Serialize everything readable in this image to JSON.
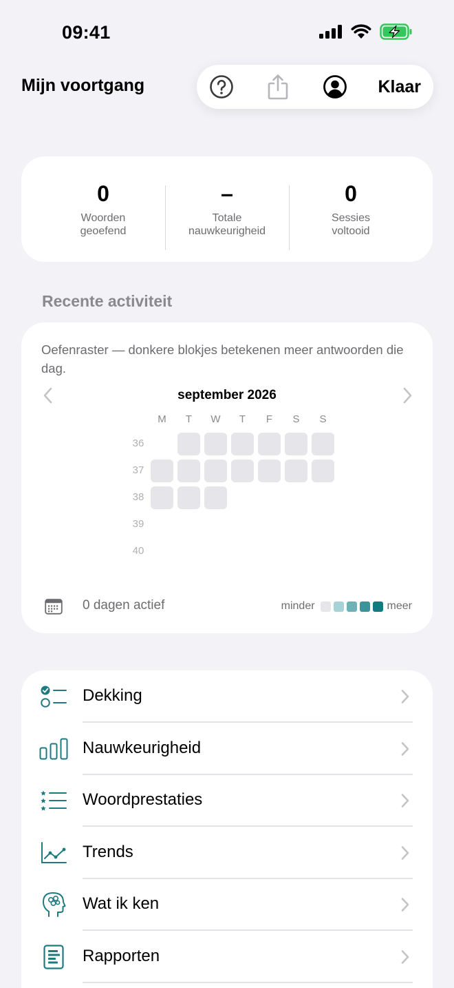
{
  "status_bar": {
    "time": "09:41"
  },
  "nav": {
    "title": "Mijn voortgang",
    "done_label": "Klaar",
    "icons": [
      "help-icon",
      "share-icon",
      "account-icon"
    ]
  },
  "stats": [
    {
      "value": "0",
      "label_line1": "Woorden",
      "label_line2": "geoefend"
    },
    {
      "value": "–",
      "label_line1": "Totale",
      "label_line2": "nauwkeurigheid"
    },
    {
      "value": "0",
      "label_line1": "Sessies",
      "label_line2": "voltooid"
    }
  ],
  "activity": {
    "section_title": "Recente activiteit",
    "description": "Oefenraster — donkere blokjes betekenen meer antwoorden die dag.",
    "month": "september 2026",
    "weekdays": [
      "M",
      "T",
      "W",
      "T",
      "F",
      "S",
      "S"
    ],
    "weeks": [
      "36",
      "37",
      "38",
      "39",
      "40"
    ],
    "active_days_text": "0 dagen actief",
    "legend_less": "minder",
    "legend_more": "meer",
    "legend_colors": [
      "#e5e5ea",
      "#a6d3d6",
      "#6fb2b6",
      "#3b9499",
      "#127a80"
    ],
    "empty_cell_color": "#e5e5ea"
  },
  "menu": {
    "accent_color": "#1f7a80",
    "items": [
      {
        "label": "Dekking",
        "icon": "checklist-icon"
      },
      {
        "label": "Nauwkeurigheid",
        "icon": "bar-chart-icon"
      },
      {
        "label": "Woordprestaties",
        "icon": "star-list-icon"
      },
      {
        "label": "Trends",
        "icon": "trend-chart-icon"
      },
      {
        "label": "Wat ik ken",
        "icon": "head-brain-icon"
      },
      {
        "label": "Rapporten",
        "icon": "report-icon"
      }
    ]
  }
}
